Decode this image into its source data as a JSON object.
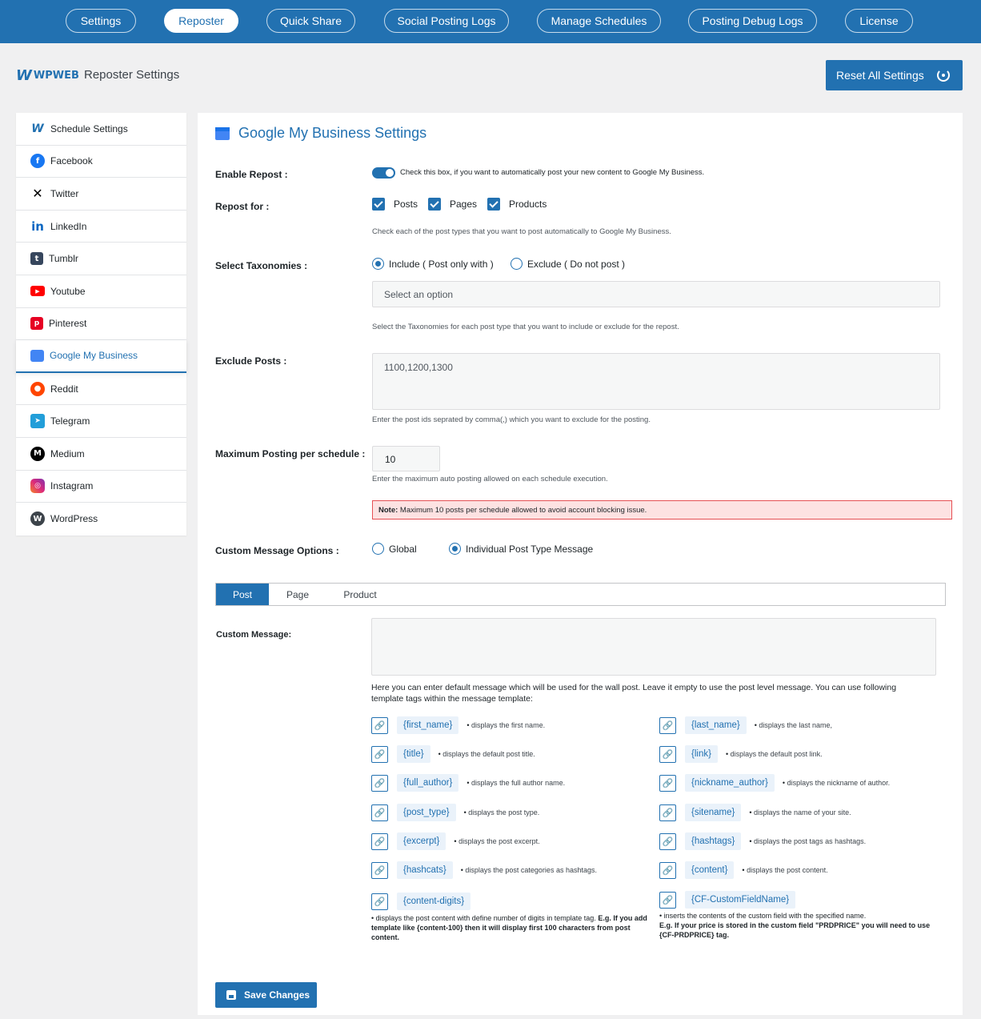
{
  "nav": {
    "tabs": [
      "Settings",
      "Reposter",
      "Quick Share",
      "Social Posting Logs",
      "Manage Schedules",
      "Posting Debug Logs",
      "License"
    ],
    "active_tab": "Reposter"
  },
  "header": {
    "logo_mark": "W",
    "logo_text": "WPWEB",
    "title": "Reposter Settings",
    "reset_label": "Reset All Settings"
  },
  "sidebar": {
    "items": [
      {
        "label": "Schedule Settings",
        "icon": "wpweb-icon"
      },
      {
        "label": "Facebook",
        "icon": "facebook-icon"
      },
      {
        "label": "Twitter",
        "icon": "twitter-x-icon"
      },
      {
        "label": "LinkedIn",
        "icon": "linkedin-icon"
      },
      {
        "label": "Tumblr",
        "icon": "tumblr-icon"
      },
      {
        "label": "Youtube",
        "icon": "youtube-icon"
      },
      {
        "label": "Pinterest",
        "icon": "pinterest-icon"
      },
      {
        "label": "Google My Business",
        "icon": "google-my-business-icon"
      },
      {
        "label": "Reddit",
        "icon": "reddit-icon"
      },
      {
        "label": "Telegram",
        "icon": "telegram-icon"
      },
      {
        "label": "Medium",
        "icon": "medium-icon"
      },
      {
        "label": "Instagram",
        "icon": "instagram-icon"
      },
      {
        "label": "WordPress",
        "icon": "wordpress-icon"
      }
    ],
    "active": "Google My Business"
  },
  "main": {
    "title": "Google My Business Settings",
    "enable_repost": {
      "label": "Enable Repost :",
      "enabled": true,
      "description": "Check this box, if you want to automatically post your new content to Google My Business."
    },
    "repost_for": {
      "label": "Repost for :",
      "options": [
        "Posts",
        "Pages",
        "Products"
      ],
      "description": "Check each of the post types that you want to post automatically to Google My Business."
    },
    "taxonomies": {
      "label": "Select Taxonomies :",
      "include_label": "Include ( Post only with )",
      "exclude_label": "Exclude ( Do not post )",
      "selected": "include",
      "select_placeholder": "Select an option",
      "description": "Select the Taxonomies for each post type that you want to include or exclude for the repost."
    },
    "exclude_posts": {
      "label": "Exclude Posts :",
      "value": "1100,1200,1300",
      "description": "Enter the post ids seprated by comma(,) which you want to exclude for the posting."
    },
    "max_posting": {
      "label": "Maximum Posting per schedule :",
      "value": "10",
      "description": "Enter the maximum auto posting allowed on each schedule execution.",
      "note_prefix": "Note:",
      "note_text": " Maximum 10 posts per schedule allowed to avoid account blocking issue."
    },
    "custom_message_options": {
      "label": "Custom Message Options :",
      "global_label": "Global",
      "individual_label": "Individual Post Type Message",
      "selected": "individual"
    },
    "message_tabs": [
      "Post",
      "Page",
      "Product"
    ],
    "active_message_tab": "Post",
    "custom_message": {
      "label": "Custom Message:",
      "value": "",
      "help": "Here you can enter default message which will be used for the wall post. Leave it empty to use the post level message. You can use following template tags within the message template:"
    },
    "template_tags_left": [
      {
        "tag": "{first_name}",
        "desc": "displays the first name."
      },
      {
        "tag": "{title}",
        "desc": "displays the default post title."
      },
      {
        "tag": "{full_author}",
        "desc": "displays the full author name."
      },
      {
        "tag": "{post_type}",
        "desc": "displays the post type."
      },
      {
        "tag": "{excerpt}",
        "desc": "displays the post excerpt."
      },
      {
        "tag": "{hashcats}",
        "desc": "displays the post categories as hashtags."
      },
      {
        "tag": "{content-digits}",
        "desc": ""
      }
    ],
    "template_tags_right": [
      {
        "tag": "{last_name}",
        "desc": "displays the last name,"
      },
      {
        "tag": "{link}",
        "desc": "displays the default post link."
      },
      {
        "tag": "{nickname_author}",
        "desc": "displays the nickname of author."
      },
      {
        "tag": "{sitename}",
        "desc": "displays the name of your site."
      },
      {
        "tag": "{hashtags}",
        "desc": "displays the post tags as hashtags."
      },
      {
        "tag": "{content}",
        "desc": "displays the post content."
      },
      {
        "tag": "{CF-CustomFieldName}",
        "desc": ""
      }
    ],
    "content_digits_desc": "displays the post content with define number of digits in template tag.",
    "content_digits_example": "E.g. If you add template like {content-100} then it will display first 100 characters from post content.",
    "cf_desc": "inserts the contents of the custom field with the specified name.",
    "cf_example": "E.g. If your price is stored in the custom field \"PRDPRICE\" you will need to use {CF-PRDPRICE} tag.",
    "save_label": "Save Changes"
  },
  "colors": {
    "accent": "#2271b1",
    "note_bg": "#fde2e2",
    "note_border": "#e65054"
  }
}
